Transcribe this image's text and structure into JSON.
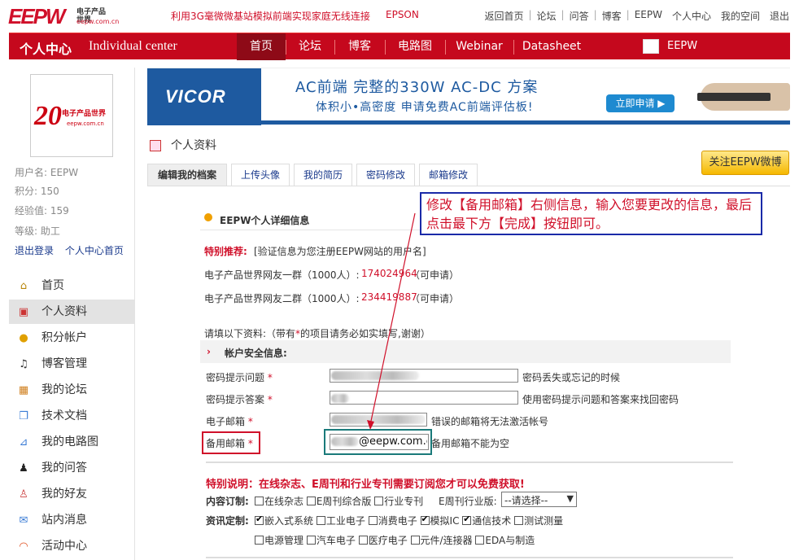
{
  "top": {
    "logo_text": "EEPW",
    "logo_cn": "电子产品世界",
    "logo_url": "eepw.com.cn",
    "promo": "利用3G毫微微基站模拟前端实现家庭无线连接",
    "epson": "EPSON",
    "links": [
      "返回首页",
      "论坛",
      "问答",
      "博客",
      "EEPW",
      "个人中心",
      "我的空间",
      "退出"
    ]
  },
  "nav": {
    "title_cn": "个人中心",
    "title_en": "Individual center",
    "tabs": [
      "首页",
      "论坛",
      "博客",
      "电路图",
      "Webinar",
      "Datasheet"
    ],
    "eepw": "EEPW"
  },
  "sidebar": {
    "avatar_num": "20",
    "avatar_text": "电子产品世界",
    "avatar_url": "eepw.com.cn",
    "username": "用户名: EEPW",
    "points": "积分: 150",
    "exp": "经验值: 159",
    "level": "等级: 助工",
    "logout": "退出登录",
    "home": "个人中心首页",
    "menu": [
      {
        "label": "首页",
        "icon": "home-icon"
      },
      {
        "label": "个人资料",
        "icon": "profile-icon"
      },
      {
        "label": "积分帐户",
        "icon": "coins-icon"
      },
      {
        "label": "博客管理",
        "icon": "music-icon"
      },
      {
        "label": "我的论坛",
        "icon": "grid-icon"
      },
      {
        "label": "技术文档",
        "icon": "document-icon"
      },
      {
        "label": "我的电路图",
        "icon": "chart-icon"
      },
      {
        "label": "我的问答",
        "icon": "penguin-icon"
      },
      {
        "label": "我的好友",
        "icon": "person-icon"
      },
      {
        "label": "站内消息",
        "icon": "mail-icon"
      },
      {
        "label": "活动中心",
        "icon": "rainbow-icon"
      }
    ]
  },
  "banner": {
    "brand": "VICOR",
    "line1": "AC前端  完整的330W  AC-DC 方案",
    "line2": "体积小•高密度   申请免费AC前端评估板!",
    "button": "立即申请 ▶"
  },
  "section": {
    "title": "个人资料",
    "follow": "关注EEPW微博",
    "tabs": [
      "编辑我的档案",
      "上传头像",
      "我的简历",
      "密码修改",
      "邮箱修改"
    ]
  },
  "form": {
    "heading": "EEPW个人详细信息",
    "rec_label": "特别推荐:",
    "rec_text": "[验证信息为您注册EEPW网站的用户名]",
    "group1_label": "电子产品世界网友一群（1000人）:",
    "group1_num": "174024964",
    "group1_tail": "（可申请）",
    "group2_label": "电子产品世界网友二群（1000人）:",
    "group2_num": "234419887",
    "group2_tail": "（可申请）",
    "fill_note_a": "请填以下资料:（带有",
    "fill_note_star": "*",
    "fill_note_b": "的项目请务必如实填写,谢谢）",
    "security_title": "帐户安全信息:",
    "star": "*",
    "q_label": "密码提示问题",
    "q_hint": "密码丢失或忘记的时候",
    "a_label": "密码提示答案",
    "a_hint": "使用密码提示问题和答案来找回密码",
    "email_label": "电子邮箱",
    "email_hint": "错误的邮箱将无法激活帐号",
    "backup_label": "备用邮箱",
    "backup_value": "@eepw.com.c",
    "backup_hint": "备用邮箱不能为空",
    "special": "特别说明：在线杂志、E周刊和行业专刊需要订阅您才可以免费获取!",
    "sub_label": "内容订制:",
    "sub_items": [
      {
        "label": "在线杂志",
        "checked": false
      },
      {
        "label": "E周刊综合版",
        "checked": false
      },
      {
        "label": "行业专刊",
        "checked": false
      }
    ],
    "industry_label": "E周刊行业版:",
    "industry_select": "--请选择--",
    "info_label": "资讯定制:",
    "info_items": [
      {
        "label": "嵌入式系统",
        "checked": true
      },
      {
        "label": "工业电子",
        "checked": false
      },
      {
        "label": "消费电子",
        "checked": false
      },
      {
        "label": "模拟IC",
        "checked": true
      },
      {
        "label": "通信技术",
        "checked": true
      },
      {
        "label": "测试测量",
        "checked": false
      }
    ],
    "info_items2": [
      {
        "label": "电源管理",
        "checked": false
      },
      {
        "label": "汽车电子",
        "checked": false
      },
      {
        "label": "医疗电子",
        "checked": false
      },
      {
        "label": "元件/连接器",
        "checked": false
      },
      {
        "label": "EDA与制造",
        "checked": false
      }
    ]
  },
  "annotation": {
    "callout": "修改【备用邮箱】右侧信息，输入您要更改的信息，最后点击最下方【完成】按钮即可。"
  }
}
